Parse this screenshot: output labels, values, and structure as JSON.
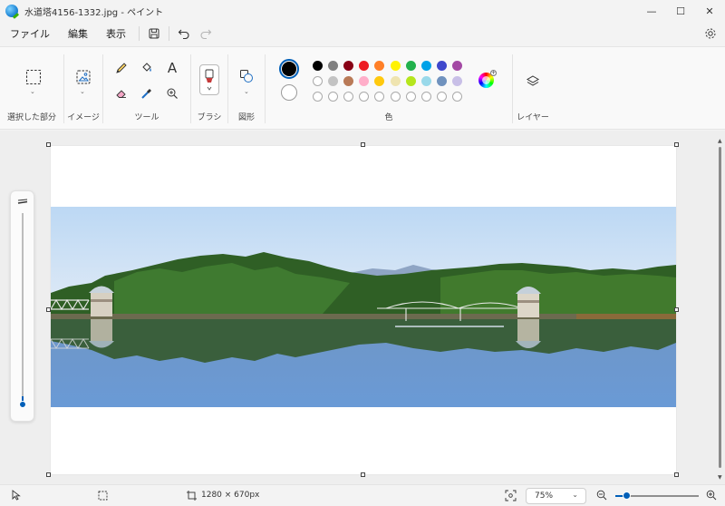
{
  "title": "水道塔4156-1332.jpg - ペイント",
  "window_controls": {
    "minimize": "—",
    "maximize": "☐",
    "close": "✕"
  },
  "menu": {
    "file": "ファイル",
    "edit": "編集",
    "view": "表示"
  },
  "ribbon": {
    "selection_label": "選択した部分",
    "image_label": "イメージ",
    "tools_label": "ツール",
    "brush_label": "ブラシ",
    "shapes_label": "図形",
    "colors_label": "色",
    "layers_label": "レイヤー",
    "text_tool_glyph": "A"
  },
  "colors": {
    "primary": "#000000",
    "secondary": "#ffffff",
    "palette_row1": [
      "#000000",
      "#7f7f7f",
      "#880015",
      "#ed1c24",
      "#ff7f27",
      "#fff200",
      "#22b14c",
      "#00a2e8",
      "#3f48cc",
      "#a349a4"
    ],
    "palette_row2": [
      "#ffffff",
      "#c3c3c3",
      "#b97a57",
      "#ffaec9",
      "#ffc90e",
      "#efe4b0",
      "#b5e61d",
      "#99d9ea",
      "#7092be",
      "#c8bfe7"
    ],
    "accent": "#005fb8"
  },
  "status": {
    "canvas_size": "1280 × 670px",
    "zoom": "75%",
    "zoom_fraction": 0.75
  }
}
